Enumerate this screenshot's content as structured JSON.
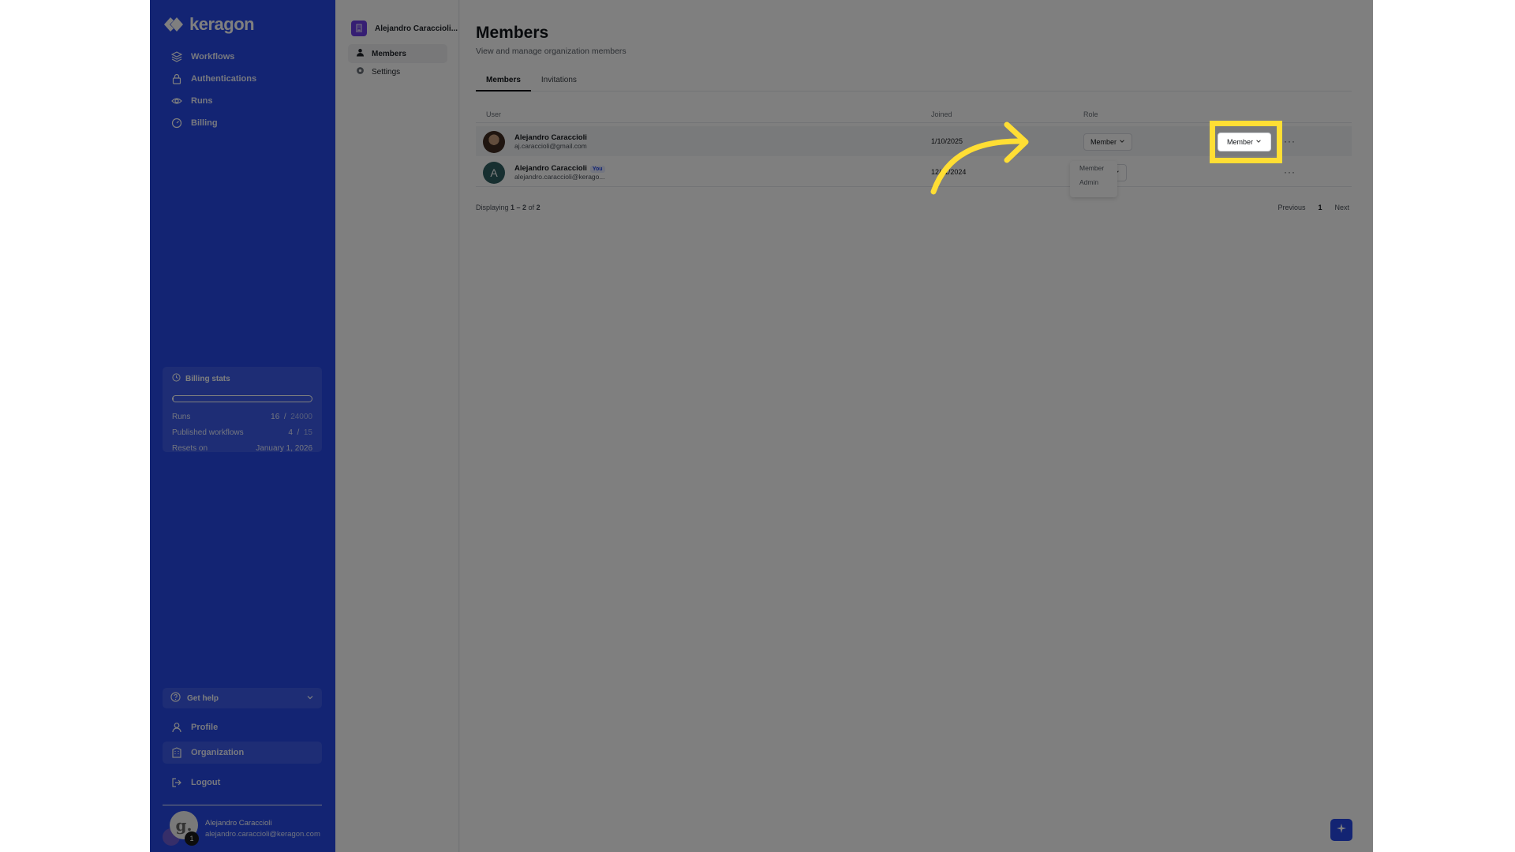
{
  "brand": {
    "name": "keragon"
  },
  "nav": {
    "items": [
      {
        "label": "Workflows",
        "icon": "layers-icon"
      },
      {
        "label": "Authentications",
        "icon": "lock-icon"
      },
      {
        "label": "Runs",
        "icon": "eye-icon"
      },
      {
        "label": "Billing",
        "icon": "gauge-icon"
      }
    ]
  },
  "billing_stats": {
    "title": "Billing stats",
    "progress": 0.0007,
    "rows": [
      {
        "label": "Runs",
        "used": "16",
        "sep": "/",
        "limit": "24000"
      },
      {
        "label": "Published workflows",
        "used": "4",
        "sep": "/",
        "limit": "15"
      },
      {
        "label": "Resets on",
        "value": "January 1, 2026"
      }
    ]
  },
  "help": {
    "label": "Get help"
  },
  "lower_nav": [
    {
      "label": "Profile",
      "icon": "user-icon"
    },
    {
      "label": "Organization",
      "icon": "building-icon",
      "active": true
    }
  ],
  "logout": {
    "label": "Logout"
  },
  "user": {
    "name": "Alejandro Caraccioli",
    "email": "alejandro.caraccioli@keragon.com",
    "avatar_letter": "g.",
    "notifications": "1"
  },
  "org": {
    "name": "Alejandro Caraccioli...",
    "items": [
      "Members",
      "Settings"
    ]
  },
  "page": {
    "title": "Members",
    "subtitle": "View and manage organization members"
  },
  "tabs": [
    "Members",
    "Invitations"
  ],
  "table": {
    "headers": {
      "user": "User",
      "joined": "Joined",
      "role": "Role"
    },
    "rows": [
      {
        "name": "Alejandro Caraccioli",
        "email": "aj.caraccioli@gmail.com",
        "joined": "1/10/2025",
        "role": "Member",
        "more": "···"
      },
      {
        "name": "Alejandro Caraccioli",
        "you": "You",
        "email": "alejandro.caraccioli@kerago...",
        "joined": "12/11/2024",
        "role": "Admin",
        "more": "···",
        "avatar_letter": "A"
      }
    ]
  },
  "role_options": [
    "Member",
    "Admin"
  ],
  "pagination": {
    "prefix": "Displaying",
    "range": "1 – 2",
    "of": "of",
    "total": "2",
    "previous": "Previous",
    "page": "1",
    "next": "Next"
  },
  "colors": {
    "sidebar": "#2749e6",
    "highlight": "#ffde34",
    "accent_purple": "#6d3ce6"
  }
}
